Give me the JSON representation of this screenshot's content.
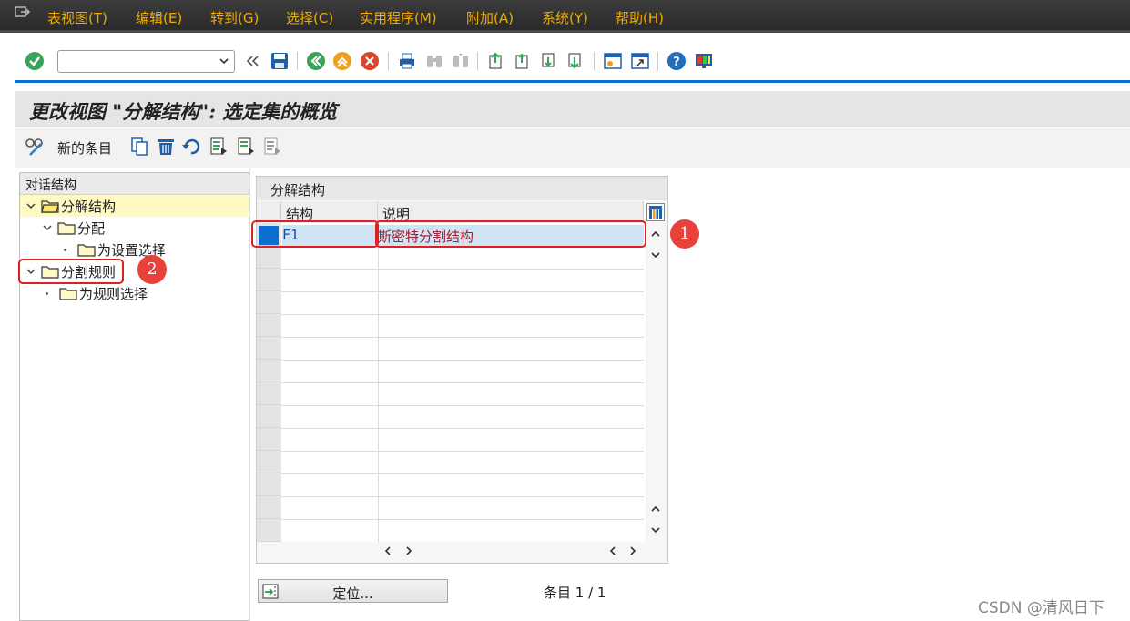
{
  "menu": {
    "items": [
      "表视图(T)",
      "编辑(E)",
      "转到(G)",
      "选择(C)",
      "实用程序(M)",
      "附加(A)",
      "系统(Y)",
      "帮助(H)"
    ]
  },
  "toolbar": {
    "command_field_value": "",
    "icons": [
      "enter-icon",
      "back-icon",
      "exit-icon",
      "cancel-icon",
      "print-icon",
      "find-icon",
      "find-next-icon",
      "first-page-icon",
      "prev-page-icon",
      "next-page-icon",
      "last-page-icon",
      "new-session-icon",
      "shortcut-icon",
      "help-icon",
      "layout-icon"
    ]
  },
  "title": "更改视图 \"分解结构\": 选定集的概览",
  "app_toolbar": {
    "new_entries_label": "新的条目"
  },
  "tree": {
    "header": "对话结构",
    "items": [
      {
        "label": "分解结构",
        "expanded": true,
        "selected": true
      },
      {
        "label": "分配",
        "expanded": true
      },
      {
        "label": "为设置选择",
        "leaf": true
      },
      {
        "label": "分割规则",
        "expanded": true
      },
      {
        "label": "为规则选择",
        "leaf": true
      }
    ]
  },
  "table": {
    "title": "分解结构",
    "columns": [
      "结构",
      "说明"
    ],
    "rows": [
      {
        "structure": "F1",
        "description": "斯密特分割结构"
      }
    ]
  },
  "bottom": {
    "position_button": "定位...",
    "entry_count": "条目 1 / 1"
  },
  "annotations": {
    "badge_1": "1",
    "badge_2": "2"
  },
  "watermark": "CSDN @清风日下",
  "colors": {
    "menu_text": "#f0ab00",
    "accent_blue": "#0a6ed1",
    "annotation_red": "#e02020",
    "selected_tree_row": "#fff9c4",
    "selected_table_row": "#cfe5f5"
  }
}
